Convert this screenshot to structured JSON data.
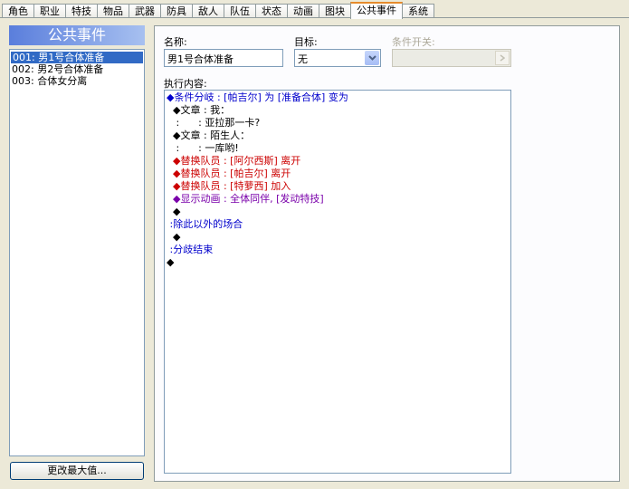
{
  "tabs": [
    "角色",
    "职业",
    "特技",
    "物品",
    "武器",
    "防具",
    "敌人",
    "队伍",
    "状态",
    "动画",
    "图块",
    "公共事件",
    "系统"
  ],
  "active_tab": "公共事件",
  "left_panel": {
    "title": "公共事件",
    "events": [
      {
        "id": "001",
        "name": "男1号合体准备",
        "selected": true
      },
      {
        "id": "002",
        "name": "男2号合体准备",
        "selected": false
      },
      {
        "id": "003",
        "name": "合体女分离",
        "selected": false
      }
    ],
    "max_button": "更改最大值..."
  },
  "form": {
    "name_label": "名称:",
    "name_value": "男1号合体准备",
    "target_label": "目标:",
    "target_value": "无",
    "switch_label": "条件开关:",
    "switch_value": "",
    "exec_label": "执行内容:"
  },
  "commands": [
    {
      "text": "◆条件分岐 : [帕吉尔] 为 [准备合体] 变为",
      "color": "blue"
    },
    {
      "text": "  ◆文章 : 我：",
      "color": "black"
    },
    {
      "text": "   :      : 亚拉那一卡?",
      "color": "black"
    },
    {
      "text": "  ◆文章 : 陌生人：",
      "color": "black"
    },
    {
      "text": "   :      : 一库哟!",
      "color": "black"
    },
    {
      "text": "  ◆替换队员 : [阿尔西斯] 离开",
      "color": "red"
    },
    {
      "text": "  ◆替换队员 : [帕吉尔] 离开",
      "color": "red"
    },
    {
      "text": "  ◆替换队员 : [特萝西] 加入",
      "color": "red"
    },
    {
      "text": "  ◆显示动画 : 全体同伴, [发动特技]",
      "color": "purple"
    },
    {
      "text": "  ◆",
      "color": "black"
    },
    {
      "text": " :除此以外的场合",
      "color": "blue"
    },
    {
      "text": "  ◆",
      "color": "black"
    },
    {
      "text": " :分歧结束",
      "color": "blue"
    },
    {
      "text": "◆",
      "color": "black"
    }
  ],
  "icons": {
    "dropdown": "chevron-down-icon"
  },
  "colors": {
    "accent": "#316ac5",
    "tab_highlight": "#e68b2c",
    "command_blue": "#0000cc",
    "command_red": "#cc0000",
    "command_purple": "#7a00aa"
  }
}
